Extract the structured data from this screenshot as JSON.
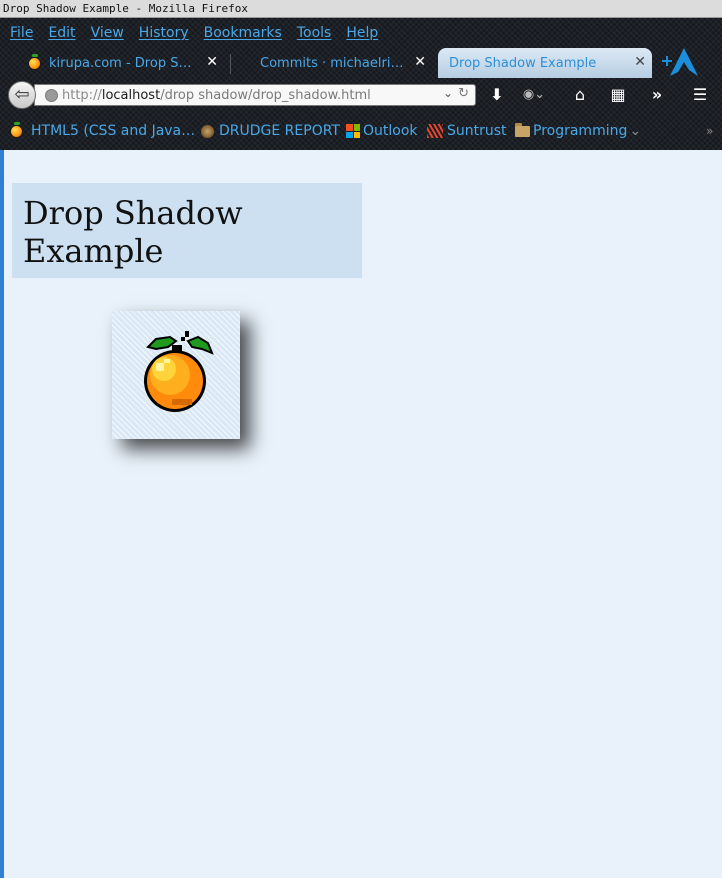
{
  "window": {
    "title": "Drop Shadow Example - Mozilla Firefox"
  },
  "menubar": [
    "File",
    "Edit",
    "View",
    "History",
    "Bookmarks",
    "Tools",
    "Help"
  ],
  "tabs": [
    {
      "title": "kirupa.com - Drop Sh…",
      "close": "✕",
      "active": false
    },
    {
      "title": "Commits · michaelriz…",
      "close": "✕",
      "active": false
    },
    {
      "title": "Drop Shadow Example",
      "close": "✕",
      "active": true
    }
  ],
  "url": {
    "scheme": "http://",
    "host": "localhost",
    "path": "/drop shadow/drop_shadow.html"
  },
  "toolbar_icons": [
    "download-icon",
    "addon-icon",
    "home-icon",
    "panel-icon",
    "overflow-icon",
    "menu-icon"
  ],
  "bookmarks": [
    {
      "label": "HTML5 (CSS and Java…",
      "icon": "orange-icon"
    },
    {
      "label": "DRUDGE REPORT",
      "icon": "drudge-icon"
    },
    {
      "label": "Outlook",
      "icon": "microsoft-icon"
    },
    {
      "label": "Suntrust",
      "icon": "suntrust-icon"
    },
    {
      "label": "Programming",
      "icon": "folder-icon"
    }
  ],
  "page": {
    "heading": "Drop Shadow Example"
  },
  "colors": {
    "menu_text": "#4aa8e8",
    "page_background": "#e9f2fb",
    "heading_background": "#cde0f1"
  }
}
